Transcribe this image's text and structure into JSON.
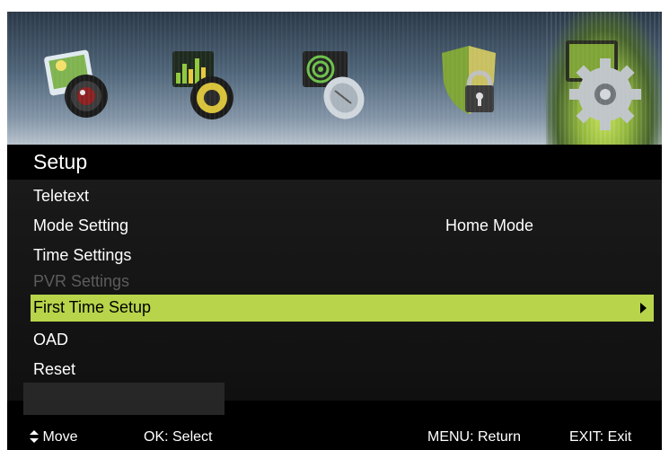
{
  "categories": [
    {
      "name": "picture",
      "icon": "picture-camera-icon"
    },
    {
      "name": "sound",
      "icon": "speaker-equalizer-icon"
    },
    {
      "name": "channel",
      "icon": "satellite-dish-icon"
    },
    {
      "name": "lock",
      "icon": "shield-padlock-icon"
    },
    {
      "name": "setup",
      "icon": "gear-monitor-icon",
      "active": true
    }
  ],
  "menu": {
    "title": "Setup",
    "items": [
      {
        "label": "Teletext"
      },
      {
        "label": "Mode Setting",
        "value": "Home Mode"
      },
      {
        "label": "Time Settings"
      },
      {
        "label": "PVR Settings",
        "disabled": true
      },
      {
        "label": "First Time Setup",
        "selected": true
      },
      {
        "label": "OAD"
      },
      {
        "label": "Reset"
      }
    ]
  },
  "footer": {
    "move": "Move",
    "select": "OK: Select",
    "return": "MENU: Return",
    "exit": "EXIT: Exit"
  },
  "colors": {
    "highlight": "#b8d44a",
    "background": "#000000",
    "disabled_text": "#5c5c5c"
  }
}
